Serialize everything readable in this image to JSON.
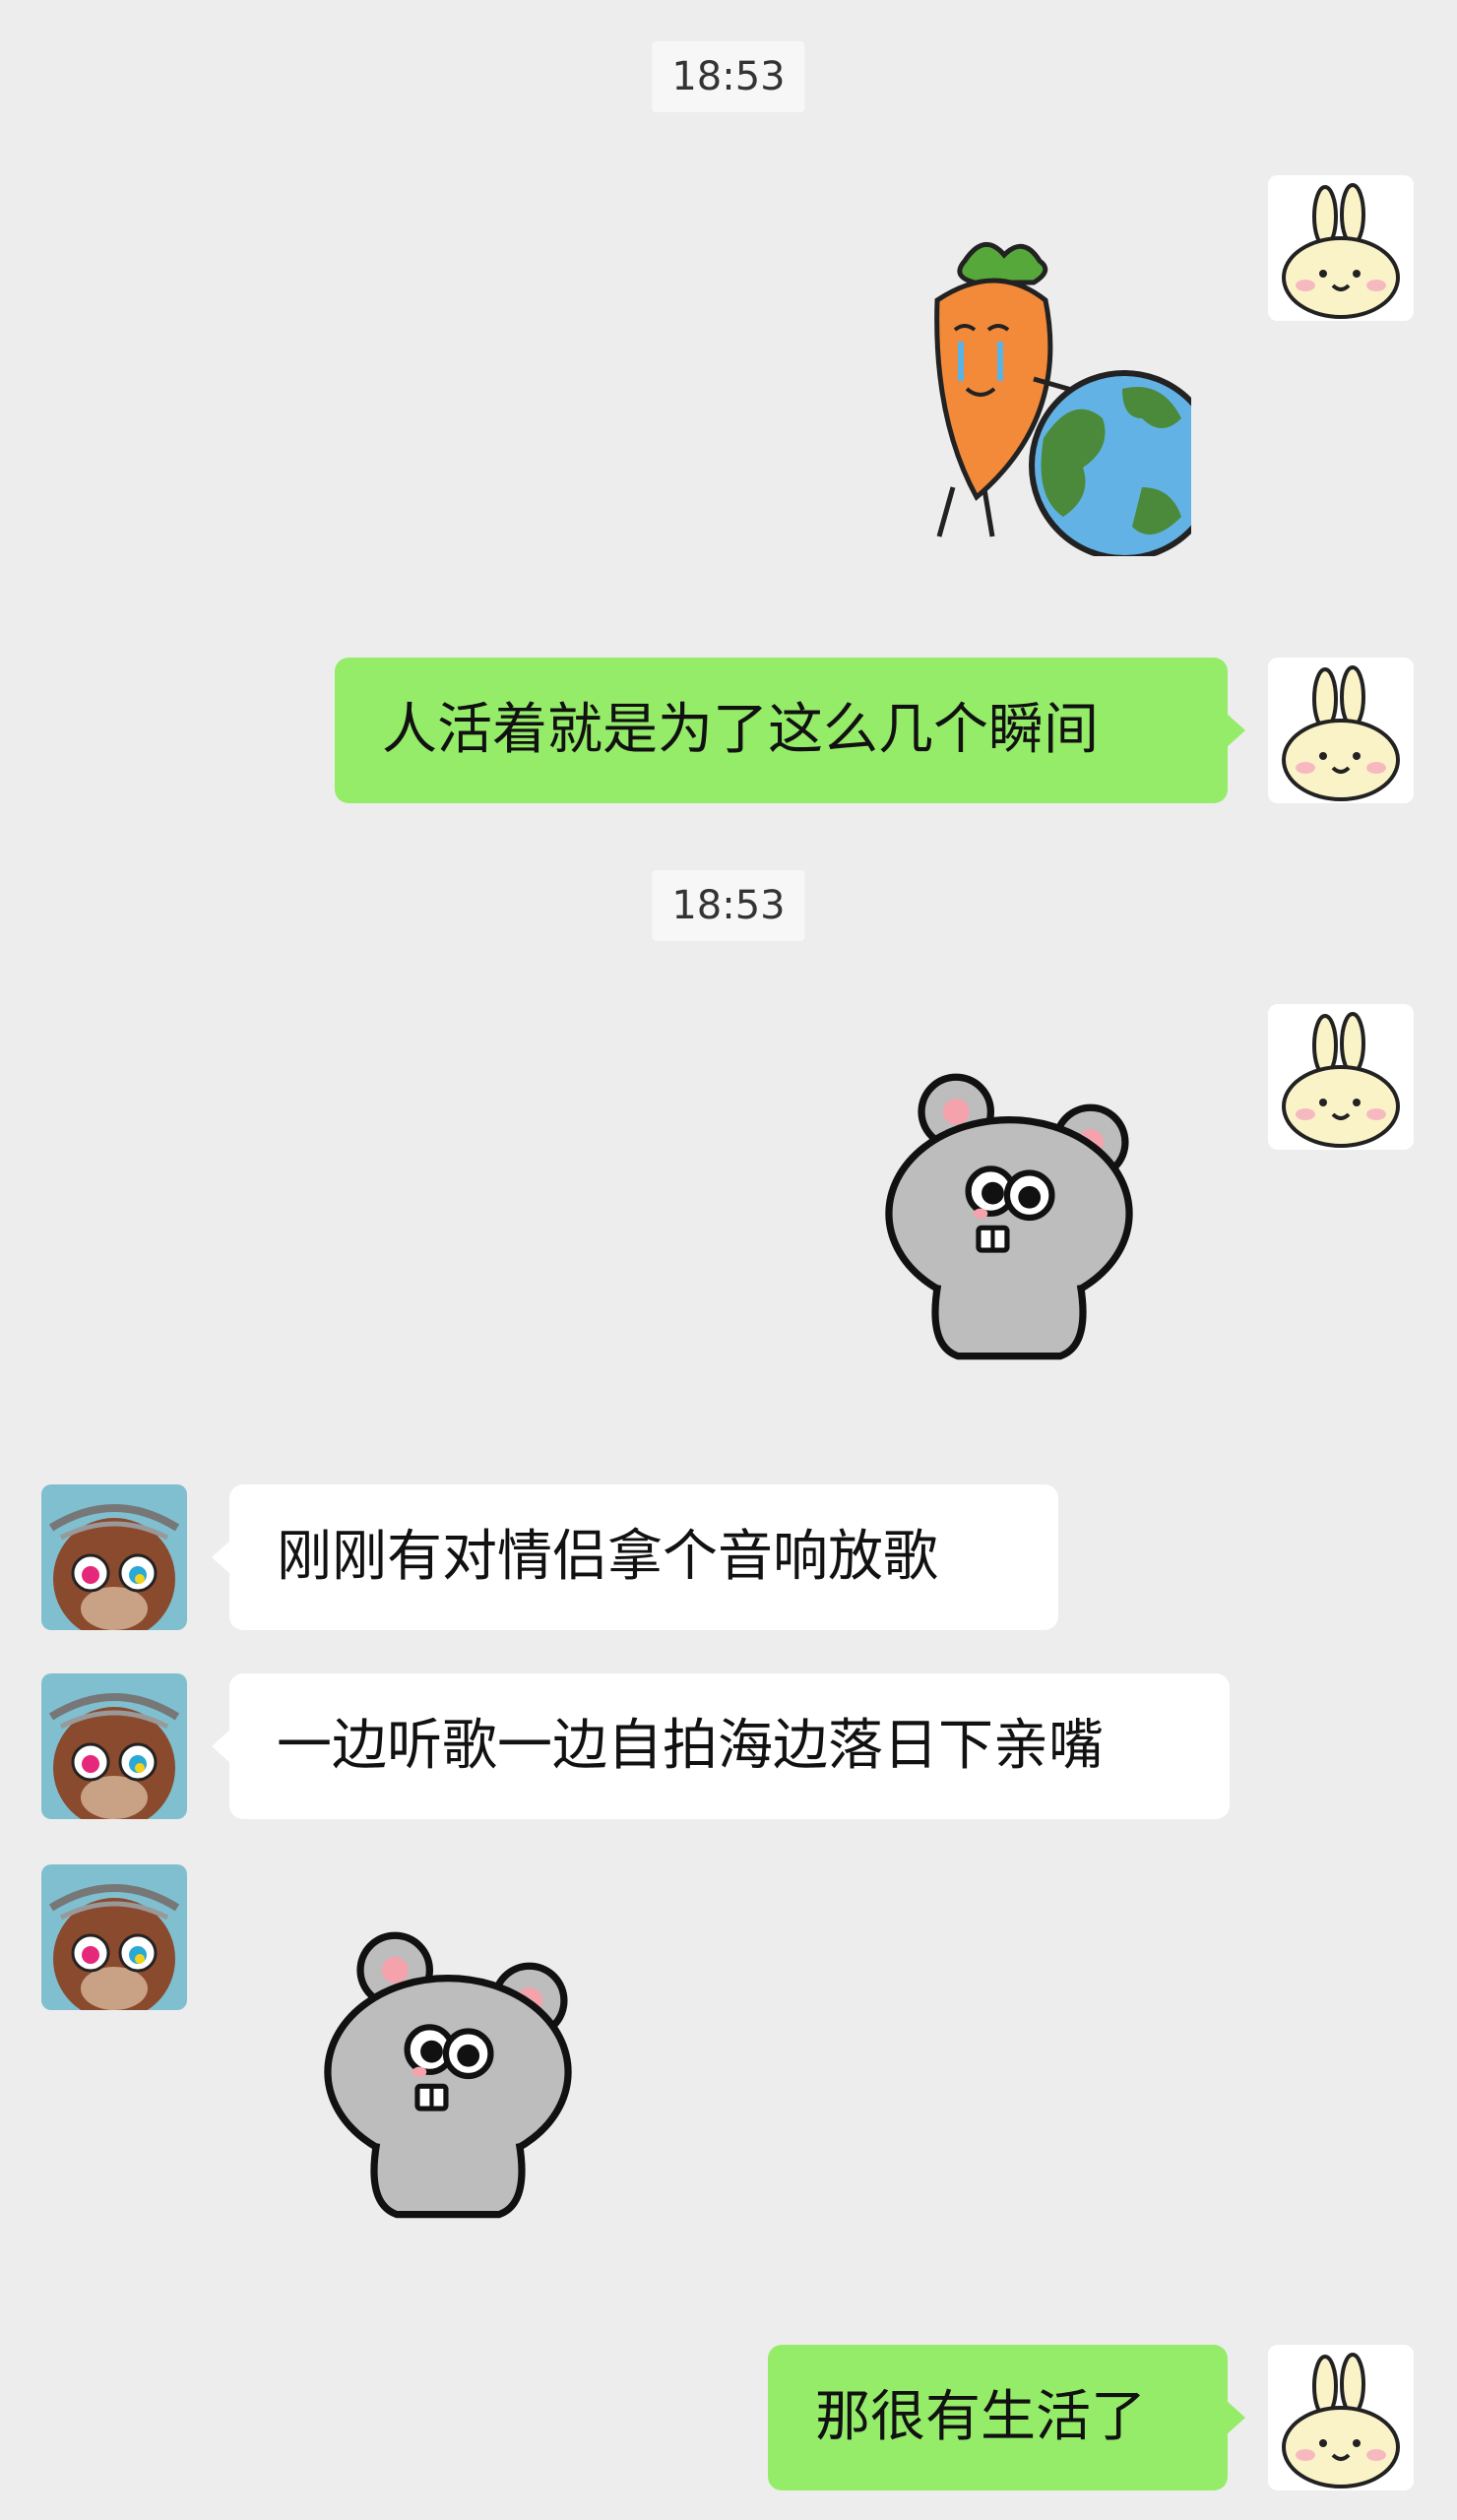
{
  "chat": {
    "time_1": "18:53",
    "time_2": "18:53",
    "messages": [
      {
        "sender": "me",
        "type": "sticker",
        "sticker": "crying-carrot-hugging-earth-sticker"
      },
      {
        "sender": "me",
        "type": "text",
        "text": "人活着就是为了这么几个瞬间"
      },
      {
        "sender": "me",
        "type": "sticker",
        "sticker": "gray-mouse-sticker"
      },
      {
        "sender": "friend",
        "type": "text",
        "text": "刚刚有对情侣拿个音响放歌"
      },
      {
        "sender": "friend",
        "type": "text",
        "text": "一边听歌一边自拍海边落日下亲嘴"
      },
      {
        "sender": "friend",
        "type": "sticker",
        "sticker": "gray-mouse-sticker"
      },
      {
        "sender": "me",
        "type": "text",
        "text": "那很有生活了"
      }
    ]
  },
  "colors": {
    "background": "#ededed",
    "my_bubble": "#95ec69",
    "friend_bubble": "#ffffff"
  },
  "icons": {
    "my_avatar": "yellow-bunny-avatar",
    "friend_avatar": "brown-bear-thorn-crown-avatar"
  }
}
